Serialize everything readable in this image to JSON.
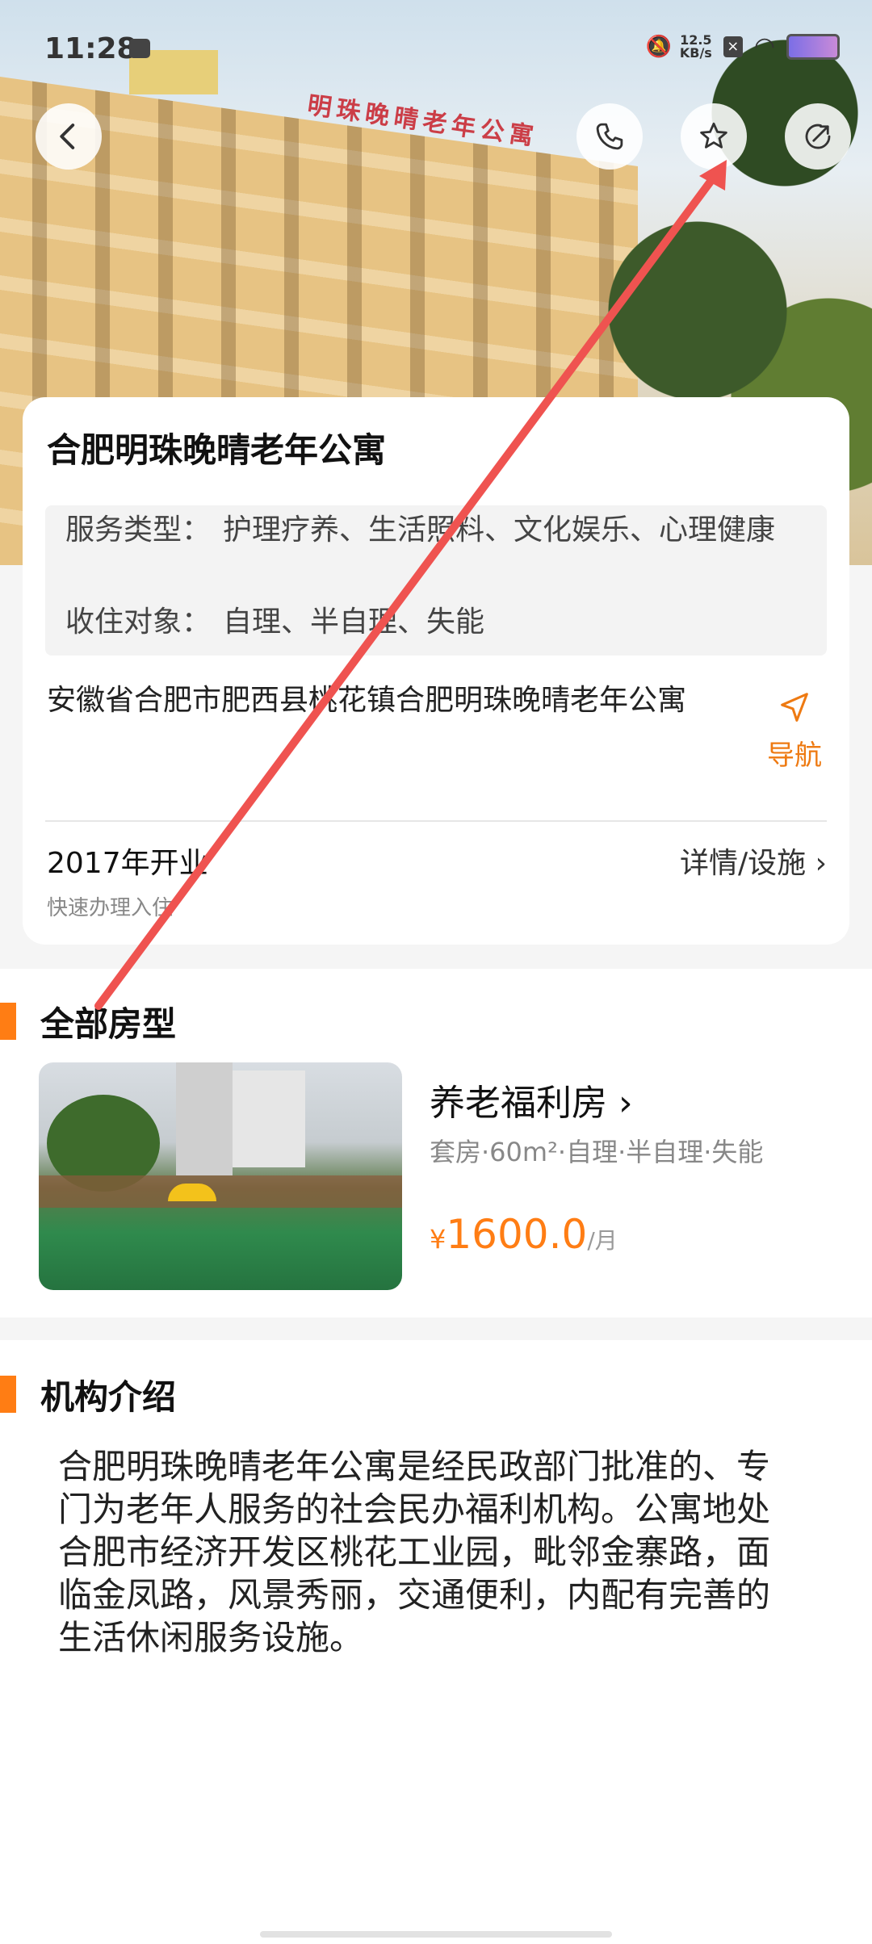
{
  "status_bar": {
    "time": "11:28",
    "net_speed_value": "12.5",
    "net_speed_unit": "KB/s"
  },
  "top_buttons": [
    "back",
    "phone",
    "favorite-star",
    "share"
  ],
  "facility": {
    "name": "合肥明珠晚晴老年公寓",
    "service_label": "服务类型：",
    "service_value": "护理疗养、生活照料、文化娱乐、心理健康",
    "target_label": "收住对象：",
    "target_value": "自理、半自理、失能",
    "address": "安徽省合肥市肥西县桃花镇合肥明珠晚晴老年公寓",
    "nav_label": "导航",
    "opened": "2017年开业",
    "detail_link": "详情/设施",
    "fast_checkin": "快速办理入住"
  },
  "rooms_section": {
    "title": "全部房型",
    "room": {
      "name": "养老福利房",
      "meta": "套房·60m²·自理·半自理·失能",
      "currency": "¥",
      "price": "1600.0",
      "unit": "/月"
    }
  },
  "intro_section": {
    "title": "机构介绍",
    "text": "合肥明珠晚晴老年公寓是经民政部门批准的、专门为老年人服务的社会民办福利机构。公寓地处合肥市经济开发区桃花工业园，毗邻金寨路，面临金凤路，风景秀丽，交通便利，内配有完善的生活休闲服务设施。"
  },
  "hero_sign_text": "明珠晚晴老年公寓",
  "colors": {
    "accent": "#ff7d14",
    "annotation_arrow": "#ef5350"
  }
}
